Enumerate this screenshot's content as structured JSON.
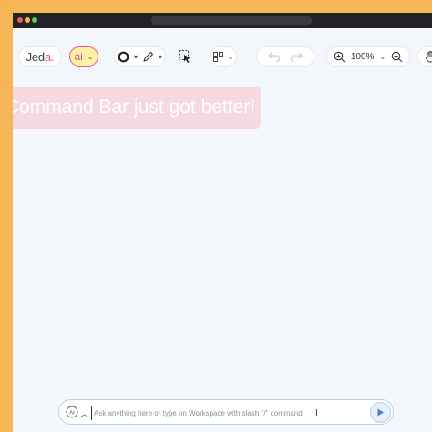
{
  "app": {
    "logo_text": "Jeda",
    "logo_accent": "a.",
    "logo_main": "Jed"
  },
  "toolbar": {
    "ai_label": "ai",
    "zoom_level": "100%"
  },
  "banner": {
    "text": "Command Bar just got better!"
  },
  "command_bar": {
    "placeholder": "Ask anything here or type on Workspace with slash \"/\" command",
    "ai_icon_text": "AI"
  },
  "colors": {
    "page_bg": "#f6b655",
    "canvas_bg": "#f3f6fb",
    "accent_pink": "#e0508a",
    "ai_pill_bg": "#fff0a8",
    "banner_bg": "#f5cdd7",
    "send_blue": "#4a7fc4"
  },
  "icons": {
    "draw": [
      "circle-shape-icon",
      "pencil-icon"
    ],
    "select": "selection-cursor-icon",
    "layout": "layout-grid-icon",
    "history": [
      "undo-icon",
      "redo-icon"
    ],
    "zoom": [
      "zoom-in-icon",
      "zoom-out-icon"
    ],
    "hand": "hand-pan-icon",
    "send": "send-icon"
  }
}
